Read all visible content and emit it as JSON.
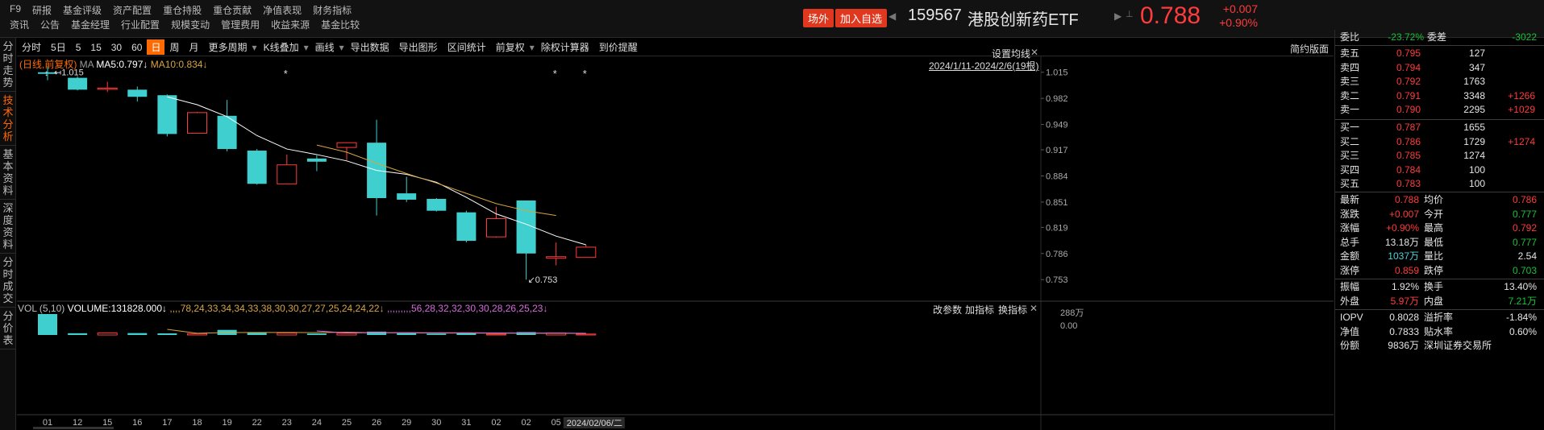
{
  "menu": {
    "row1": [
      "F9",
      "研报",
      "基金评级",
      "资产配置",
      "重仓持股",
      "重仓贡献",
      "净值表现",
      "财务指标"
    ],
    "row2": [
      "资讯",
      "公告",
      "基金经理",
      "行业配置",
      "规模变动",
      "管理费用",
      "收益来源",
      "基金比较"
    ]
  },
  "header": {
    "btn_offsite": "场外",
    "btn_watchlist": "加入自选",
    "code": "159567",
    "name": "港股创新药ETF",
    "price": "0.788",
    "change": "+0.007",
    "change_pct": "+0.90%"
  },
  "sidebar": [
    {
      "label": "分时走势",
      "active": false
    },
    {
      "label": "技术分析",
      "active": true
    },
    {
      "label": "基本资料",
      "active": false
    },
    {
      "label": "深度资料",
      "active": false
    },
    {
      "label": "分时成交",
      "active": false
    },
    {
      "label": "分价表",
      "active": false
    }
  ],
  "toolbar": {
    "items": [
      "分时",
      "5日",
      "5",
      "15",
      "30",
      "60",
      "日",
      "周",
      "月",
      "更多周期",
      "K线叠加",
      "画线",
      "导出数据",
      "导出图形",
      "区间统计",
      "前复权",
      "除权计算器",
      "到价提醒"
    ],
    "active": "日",
    "right": "简约版面"
  },
  "kline": {
    "label_main": "(日线,前复权)",
    "ma_label": "MA",
    "ma5": "MA5:0.797",
    "ma10": "MA10:0.834",
    "settings": "设置均线",
    "range": "2024/1/11-2024/2/6(19根)",
    "high_mark": "1.015",
    "low_mark": "0.753",
    "colors": {
      "up": "#ff3b3b",
      "down": "#3fcfcf",
      "ma5": "#ffffff",
      "ma10": "#d8a440"
    }
  },
  "chart_data": {
    "type": "candlestick",
    "x": [
      "01",
      "12",
      "15",
      "16",
      "17",
      "18",
      "19",
      "22",
      "23",
      "24",
      "25",
      "26",
      "29",
      "30",
      "31",
      "02",
      "02",
      "05",
      "06"
    ],
    "x_tick_labels": [
      "01",
      "12",
      "15",
      "16",
      "17",
      "18",
      "19",
      "22",
      "23",
      "24",
      "25",
      "26",
      "29",
      "30",
      "31",
      "02",
      "02",
      "05"
    ],
    "cursor_date": "2024/02/06/二",
    "ohlc": [
      {
        "o": 1.015,
        "h": 1.022,
        "l": 1.005,
        "c": 1.013
      },
      {
        "o": 1.008,
        "h": 1.01,
        "l": 0.992,
        "c": 0.993
      },
      {
        "o": 0.994,
        "h": 1.003,
        "l": 0.99,
        "c": 0.995
      },
      {
        "o": 0.993,
        "h": 0.997,
        "l": 0.978,
        "c": 0.984
      },
      {
        "o": 0.986,
        "h": 0.987,
        "l": 0.934,
        "c": 0.937
      },
      {
        "o": 0.938,
        "h": 0.965,
        "l": 0.938,
        "c": 0.964
      },
      {
        "o": 0.96,
        "h": 0.98,
        "l": 0.915,
        "c": 0.918
      },
      {
        "o": 0.916,
        "h": 0.918,
        "l": 0.873,
        "c": 0.874
      },
      {
        "o": 0.874,
        "h": 0.911,
        "l": 0.874,
        "c": 0.898
      },
      {
        "o": 0.906,
        "h": 0.91,
        "l": 0.89,
        "c": 0.902
      },
      {
        "o": 0.92,
        "h": 0.926,
        "l": 0.904,
        "c": 0.926
      },
      {
        "o": 0.926,
        "h": 0.955,
        "l": 0.834,
        "c": 0.856
      },
      {
        "o": 0.862,
        "h": 0.883,
        "l": 0.851,
        "c": 0.854
      },
      {
        "o": 0.855,
        "h": 0.856,
        "l": 0.839,
        "c": 0.84
      },
      {
        "o": 0.838,
        "h": 0.84,
        "l": 0.8,
        "c": 0.802
      },
      {
        "o": 0.807,
        "h": 0.845,
        "l": 0.806,
        "c": 0.83
      },
      {
        "o": 0.853,
        "h": 0.853,
        "l": 0.753,
        "c": 0.786
      },
      {
        "o": 0.78,
        "h": 0.8,
        "l": 0.771,
        "c": 0.782
      },
      {
        "o": 0.781,
        "h": 0.797,
        "l": 0.781,
        "c": 0.794
      }
    ],
    "ma5": [
      null,
      null,
      null,
      null,
      0.984,
      0.974,
      0.959,
      0.935,
      0.918,
      0.911,
      0.903,
      0.891,
      0.886,
      0.876,
      0.857,
      0.836,
      0.823,
      0.808,
      0.797
    ],
    "ma10": [
      null,
      null,
      null,
      null,
      null,
      null,
      null,
      null,
      null,
      0.923,
      0.914,
      0.9,
      0.887,
      0.875,
      0.862,
      0.849,
      0.84,
      0.834,
      null
    ],
    "y_ticks": [
      1.015,
      0.982,
      0.949,
      0.917,
      0.884,
      0.851,
      0.819,
      0.786,
      0.753
    ],
    "ylim": [
      0.74,
      1.03
    ],
    "markers": [
      "*",
      "*",
      "*"
    ]
  },
  "volume": {
    "label": "VOL (5,10)",
    "volume": "VOLUME:131828.000",
    "mavol1": [
      null,
      null,
      null,
      null,
      78,
      24,
      33,
      34,
      34,
      33,
      38,
      30,
      30,
      27,
      27,
      25,
      24,
      24,
      22
    ],
    "mavol2": [
      null,
      null,
      null,
      null,
      null,
      null,
      null,
      null,
      null,
      56,
      28,
      32,
      32,
      30,
      30,
      28,
      26,
      25,
      23
    ],
    "btn_params": "改参数",
    "btn_add": "加指标",
    "btn_switch": "换指标",
    "max_label": "288万",
    "zero_label": "0.00",
    "values": [
      288,
      24,
      28,
      26,
      22,
      18,
      70,
      32,
      26,
      20,
      24,
      46,
      25,
      18,
      22,
      12,
      40,
      28,
      13
    ]
  },
  "quote": {
    "weibi_label": "委比",
    "weibi": "-23.72%",
    "weicha_label": "委差",
    "weicha": "-3022",
    "sells": [
      {
        "label": "卖五",
        "price": "0.795",
        "vol": "127",
        "delta": ""
      },
      {
        "label": "卖四",
        "price": "0.794",
        "vol": "347",
        "delta": ""
      },
      {
        "label": "卖三",
        "price": "0.792",
        "vol": "1763",
        "delta": ""
      },
      {
        "label": "卖二",
        "price": "0.791",
        "vol": "3348",
        "delta": "+1266"
      },
      {
        "label": "卖一",
        "price": "0.790",
        "vol": "2295",
        "delta": "+1029"
      }
    ],
    "buys": [
      {
        "label": "买一",
        "price": "0.787",
        "vol": "1655",
        "delta": ""
      },
      {
        "label": "买二",
        "price": "0.786",
        "vol": "1729",
        "delta": "+1274"
      },
      {
        "label": "买三",
        "price": "0.785",
        "vol": "1274",
        "delta": ""
      },
      {
        "label": "买四",
        "price": "0.784",
        "vol": "100",
        "delta": ""
      },
      {
        "label": "买五",
        "price": "0.783",
        "vol": "100",
        "delta": ""
      }
    ],
    "stats": [
      [
        {
          "l": "最新",
          "v": "0.788",
          "c": "red"
        },
        {
          "l": "均价",
          "v": "0.786",
          "c": "red"
        }
      ],
      [
        {
          "l": "涨跌",
          "v": "+0.007",
          "c": "red"
        },
        {
          "l": "今开",
          "v": "0.777",
          "c": "green"
        }
      ],
      [
        {
          "l": "涨幅",
          "v": "+0.90%",
          "c": "red"
        },
        {
          "l": "最高",
          "v": "0.792",
          "c": "red"
        }
      ],
      [
        {
          "l": "总手",
          "v": "13.18万",
          "c": "white"
        },
        {
          "l": "最低",
          "v": "0.777",
          "c": "green"
        }
      ],
      [
        {
          "l": "金额",
          "v": "1037万",
          "c": "cyan"
        },
        {
          "l": "量比",
          "v": "2.54",
          "c": "white"
        }
      ],
      [
        {
          "l": "涨停",
          "v": "0.859",
          "c": "red"
        },
        {
          "l": "跌停",
          "v": "0.703",
          "c": "green"
        }
      ]
    ],
    "stats2": [
      [
        {
          "l": "振幅",
          "v": "1.92%",
          "c": "white"
        },
        {
          "l": "换手",
          "v": "13.40%",
          "c": "white"
        }
      ],
      [
        {
          "l": "外盘",
          "v": "5.97万",
          "c": "red"
        },
        {
          "l": "内盘",
          "v": "7.21万",
          "c": "green"
        }
      ]
    ],
    "stats3": [
      [
        {
          "l": "IOPV",
          "v": "0.8028",
          "c": "white"
        },
        {
          "l": "溢折率",
          "v": "-1.84%",
          "c": "white"
        }
      ],
      [
        {
          "l": "净值",
          "v": "0.7833",
          "c": "white"
        },
        {
          "l": "贴水率",
          "v": "0.60%",
          "c": "white"
        }
      ],
      [
        {
          "l": "份额",
          "v": "9836万",
          "c": "white"
        },
        {
          "l": "深圳证券交易所",
          "v": "",
          "c": "white"
        }
      ]
    ]
  }
}
